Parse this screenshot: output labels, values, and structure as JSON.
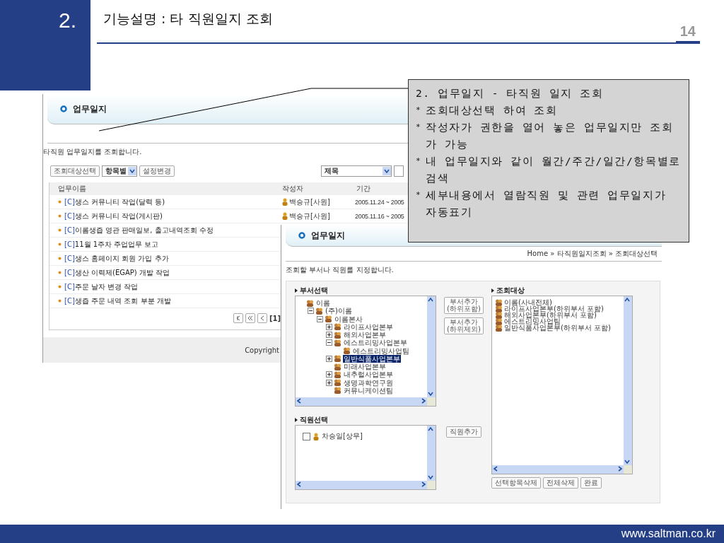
{
  "slide": {
    "number": "2.",
    "title": "기능설명 : 타 직원일지 조회",
    "page": "14"
  },
  "list_screen": {
    "header": "업무일지",
    "description": "타직원 업무일지를 조회합니다.",
    "toolbar": [
      {
        "kind": "button",
        "label": "조회대상선택"
      },
      {
        "kind": "select",
        "value": "항목별"
      },
      {
        "kind": "button",
        "label": "설정변경"
      }
    ],
    "search_select": "제목",
    "columns": [
      "업무이름",
      "작성자",
      "기간"
    ],
    "rows": [
      {
        "tag": "[C]",
        "title": "생스 커뮤니티 작업(달력 등)",
        "author": "백승규[사원]",
        "period": "2005.11.24 ~ 2005"
      },
      {
        "tag": "[C]",
        "title": "생스 커뮤니티 작업(게시판)",
        "author": "백승규[사원]",
        "period": "2005.11.16 ~ 2005"
      },
      {
        "tag": "[C]",
        "title": "이롬생즙 영관 판매일보, 출고내역조회 수정"
      },
      {
        "tag": "[C]",
        "title": "11월 1주차 주업업무 보고"
      },
      {
        "tag": "[C]",
        "title": "생스 홈페이지 회원 가입 추가"
      },
      {
        "tag": "[C]",
        "title": "생산 이력제(EGAP) 개발 작업"
      },
      {
        "tag": "[C]",
        "title": "주문 날자 변경 작업"
      },
      {
        "tag": "[C]",
        "title": "생즙 주문 내역 조회 부분 개발"
      }
    ],
    "pager": "[1]",
    "copyright": "Copyright"
  },
  "select_screen": {
    "header": "업무일지",
    "breadcrumb": "Home » 타직원일지조회 » 조회대상선택",
    "description": "조회할 부서나 직원를 지정합니다.",
    "department_label": "부서선택",
    "tree": [
      {
        "label": "이롬",
        "selected": false,
        "children": [
          {
            "label": "(주)이롬",
            "expanded": true,
            "selected": false,
            "children": [
              {
                "label": "이롬본사",
                "expanded": true,
                "selected": false,
                "children": [
                  {
                    "label": "라이프사업본부",
                    "expanded": false,
                    "selected": false
                  },
                  {
                    "label": "해외사업본부",
                    "expanded": false,
                    "selected": false
                  },
                  {
                    "label": "에스트리밍사업본부",
                    "expanded": true,
                    "selected": false,
                    "children": [
                      {
                        "label": "에스트리밍사업팀",
                        "selected": false
                      }
                    ]
                  },
                  {
                    "label": "일반식품사업본부",
                    "expanded": false,
                    "selected": true
                  },
                  {
                    "label": "미래사업본부",
                    "selected": false
                  },
                  {
                    "label": "내추럴사업본부",
                    "expanded": false,
                    "selected": false
                  },
                  {
                    "label": "생명과학연구원",
                    "expanded": false,
                    "selected": false
                  },
                  {
                    "label": "커뮤니케이션팀",
                    "selected": false
                  }
                ]
              }
            ]
          }
        ]
      }
    ],
    "add_buttons": [
      {
        "lines": [
          "부서추가",
          "(하위포함)"
        ]
      },
      {
        "lines": [
          "부서추가",
          "(하위제외)"
        ]
      }
    ],
    "target_label": "조회대상",
    "targets": [
      "이롬(사내전체)",
      "라이프사업본부(하위부서 포함)",
      "해외사업본부(하위부서 포함)",
      "에스트리밍사업팀",
      "일반식품사업본부(하위부서 포함)"
    ],
    "employee_label": "직원선택",
    "employees": [
      {
        "name": "차승일[상무]",
        "checked": false
      }
    ],
    "employee_button": "직원추가",
    "actions": [
      "선택항목삭제",
      "전체삭제",
      "완료"
    ]
  },
  "callout": {
    "title": "2. 업무일지 - 타직원 일지 조회",
    "marker": "*",
    "bullets": [
      "조회대상선택 하여 조회",
      "작성자가 권한을 열어 놓은 업무일지만 조회가 가능",
      "내 업무일지와 같이 월간/주간/일간/항목별로 검색",
      "세부내용에서 열람직원 및 관련 업무일지가 자동표기"
    ]
  },
  "footer": "www.saltman.co.kr"
}
